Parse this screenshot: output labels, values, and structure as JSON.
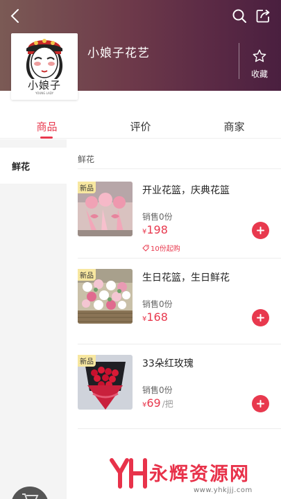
{
  "header": {
    "shop_name": "小娘子花艺",
    "favorite_label": "收藏",
    "logo_text": "小娘子",
    "logo_sub": "YOUNG LADY"
  },
  "tabs": [
    {
      "label": "商品",
      "active": true
    },
    {
      "label": "评价",
      "active": false
    },
    {
      "label": "商家",
      "active": false
    }
  ],
  "sidebar": {
    "items": [
      {
        "label": "鲜花",
        "selected": true
      }
    ]
  },
  "section": {
    "title": "鲜花"
  },
  "products": [
    {
      "badge": "新品",
      "name": "开业花篮，庆典花篮",
      "sold": "销售0份",
      "currency": "¥",
      "price": "198",
      "unit": "",
      "min_order": "10份起购"
    },
    {
      "badge": "新品",
      "name": "生日花篮，生日鲜花",
      "sold": "销售0份",
      "currency": "¥",
      "price": "168",
      "unit": "",
      "min_order": ""
    },
    {
      "badge": "新品",
      "name": "33朵红玫瑰",
      "sold": "销售0份",
      "currency": "¥",
      "price": "69",
      "unit": "/把",
      "min_order": ""
    }
  ],
  "watermark": {
    "text": "永辉资源网",
    "url": "www.yhkjjj.com"
  },
  "colors": {
    "accent": "#e8394e",
    "badge": "#f7e7a0"
  }
}
